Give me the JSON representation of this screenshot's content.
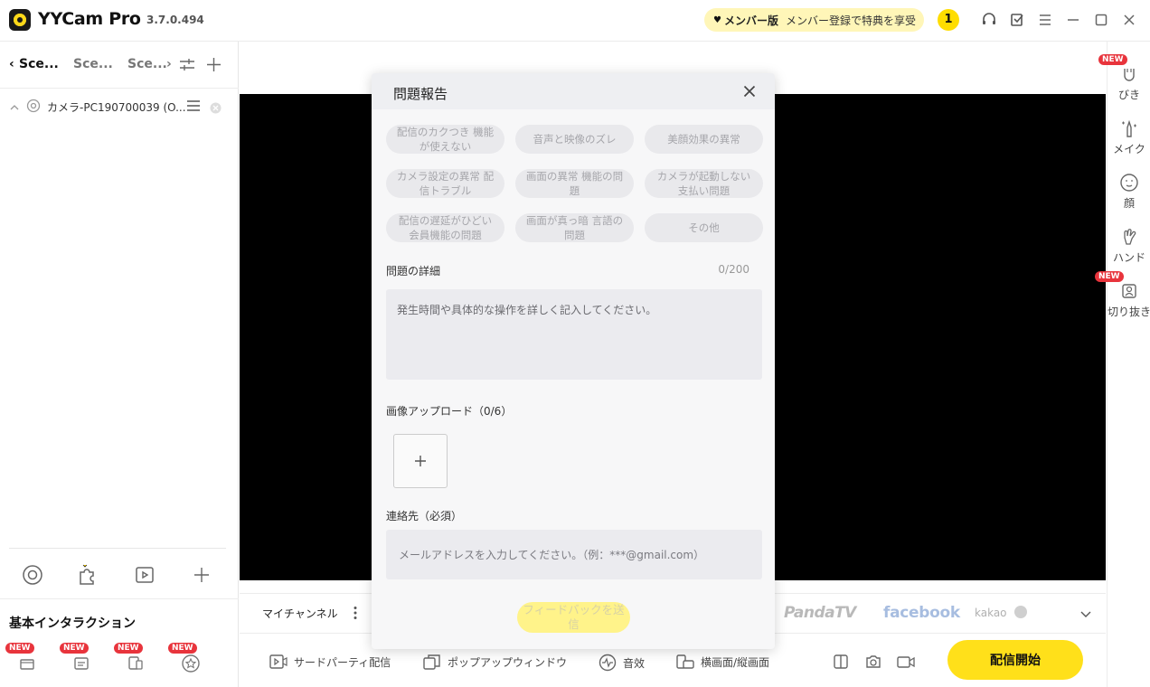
{
  "app": {
    "name": "YYCam Pro",
    "version": "3.7.0.494",
    "member_plan": "メンバー版",
    "member_promo": "メンバー登録で特典を享受",
    "notification_count": "1"
  },
  "sidebar": {
    "scene_tabs": [
      "Sce...",
      "Sce...",
      "Sce..."
    ],
    "camera_source": "カメラ-PC190700039 (O...",
    "basic_title": "基本インタラクション",
    "new_badge": "NEW"
  },
  "rail": {
    "items": [
      {
        "label": "びき",
        "icon": "face-shape-icon",
        "new": true
      },
      {
        "label": "メイク",
        "icon": "makeup-icon",
        "new": false
      },
      {
        "label": "顔",
        "icon": "face-icon",
        "new": false
      },
      {
        "label": "ハンド",
        "icon": "hand-icon",
        "new": false
      },
      {
        "label": "切り抜き",
        "icon": "cutout-icon",
        "new": true
      }
    ]
  },
  "channel_bar": {
    "label": "マイチャンネル",
    "brands": [
      "PandaTV",
      "facebook",
      "kakao"
    ]
  },
  "toolbar": {
    "third_party": "サードパーティ配信",
    "popup": "ポップアップウィンドウ",
    "sound": "音效",
    "orientation": "横画面/縦画面",
    "start": "配信開始"
  },
  "modal": {
    "title": "問題報告",
    "categories": [
      "配信のカクつき 機能が使えない",
      "音声と映像のズレ",
      "美顔効果の異常",
      "カメラ設定の異常 配信トラブル",
      "画面の異常 機能の問題",
      "カメラが起動しない 支払い問題",
      "配信の遅延がひどい 会員機能の問題",
      "画面が真っ暗 言語の問題",
      "その他"
    ],
    "detail_label": "問題の詳細",
    "detail_counter": "0/200",
    "detail_placeholder": "発生時間や具体的な操作を詳しく記入してください。",
    "upload_label": "画像アップロード（0/6）",
    "contact_label": "連絡先（必須）",
    "contact_placeholder": "メールアドレスを入力してください。（例：***@gmail.com）",
    "submit": "フィードバックを送信"
  },
  "colors": {
    "accent": "#ffe01a",
    "new_badge": "#e8343c",
    "preview": "#000000"
  }
}
